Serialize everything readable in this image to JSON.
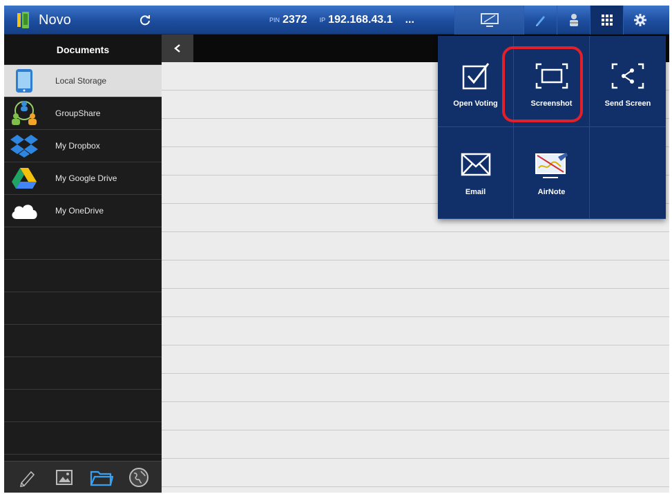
{
  "app": {
    "title": "Novo"
  },
  "connection": {
    "pin_label": "PIN",
    "pin": "2372",
    "ip_label": "IP",
    "ip": "192.168.43.1",
    "more": "..."
  },
  "topbar_icons": {
    "logo": "novo-logo-icon",
    "refresh": "refresh-icon",
    "screen": "monitor-icon",
    "pen": "pen-icon",
    "user": "user-icon",
    "apps": "grid-icon",
    "settings": "gear-icon"
  },
  "sidebar": {
    "title": "Documents",
    "items": [
      {
        "label": "Local Storage",
        "icon": "tablet-icon",
        "active": true
      },
      {
        "label": "GroupShare",
        "icon": "group-icon"
      },
      {
        "label": "My Dropbox",
        "icon": "dropbox-icon"
      },
      {
        "label": "My Google Drive",
        "icon": "google-drive-icon"
      },
      {
        "label": "My OneDrive",
        "icon": "cloud-icon"
      }
    ]
  },
  "bottom_tabs": [
    {
      "icon": "pencil-icon"
    },
    {
      "icon": "image-icon"
    },
    {
      "icon": "folder-icon",
      "active": true
    },
    {
      "icon": "globe-icon"
    }
  ],
  "apps_menu": {
    "tiles": [
      {
        "label": "Open Voting",
        "icon": "checkbox-icon"
      },
      {
        "label": "Screenshot",
        "icon": "screenshot-icon",
        "highlighted": true
      },
      {
        "label": "Send Screen",
        "icon": "share-screen-icon"
      },
      {
        "label": "Email",
        "icon": "envelope-icon"
      },
      {
        "label": "AirNote",
        "icon": "airnote-icon"
      }
    ]
  },
  "colors": {
    "topbar": "#1d4d9e",
    "popup": "#11306a",
    "highlight": "#e0202a",
    "sidebar": "#1c1c1c"
  }
}
